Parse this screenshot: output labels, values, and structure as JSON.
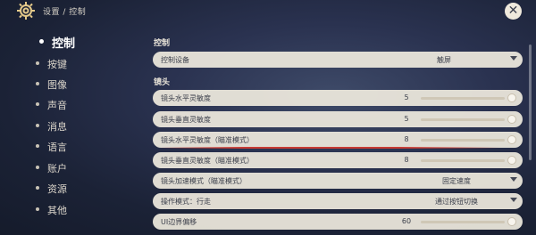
{
  "header": {
    "breadcrumb": "设置 / 控制",
    "icon": "gear-icon",
    "close_icon": "close-icon"
  },
  "sidebar": {
    "items": [
      {
        "label": "控制",
        "active": true
      },
      {
        "label": "按键"
      },
      {
        "label": "图像"
      },
      {
        "label": "声音"
      },
      {
        "label": "消息"
      },
      {
        "label": "语言"
      },
      {
        "label": "账户"
      },
      {
        "label": "资源"
      },
      {
        "label": "其他"
      }
    ]
  },
  "sections": {
    "control": "控制",
    "camera": "镜头"
  },
  "settings": {
    "device": {
      "label": "控制设备",
      "value": "触屏"
    },
    "h_sens": {
      "label": "镜头水平灵敏度",
      "value": "5"
    },
    "v_sens": {
      "label": "镜头垂直灵敏度",
      "value": "5"
    },
    "h_sens_aim": {
      "label": "镜头水平灵敏度（瞄准模式）",
      "value": "8"
    },
    "v_sens_aim": {
      "label": "镜头垂直灵敏度（瞄准模式）",
      "value": "8"
    },
    "accel_aim": {
      "label": "镜头加速模式（瞄准模式）",
      "value": "固定速度"
    },
    "op_mode": {
      "label": "操作模式：行走",
      "value": "通过按钮切换"
    },
    "ui_margin": {
      "label": "UI边界偏移",
      "value": "60"
    }
  },
  "colors": {
    "row_bg": "#eee9de",
    "text_dark": "#3a3e4a",
    "accent_red": "#c73a33"
  }
}
